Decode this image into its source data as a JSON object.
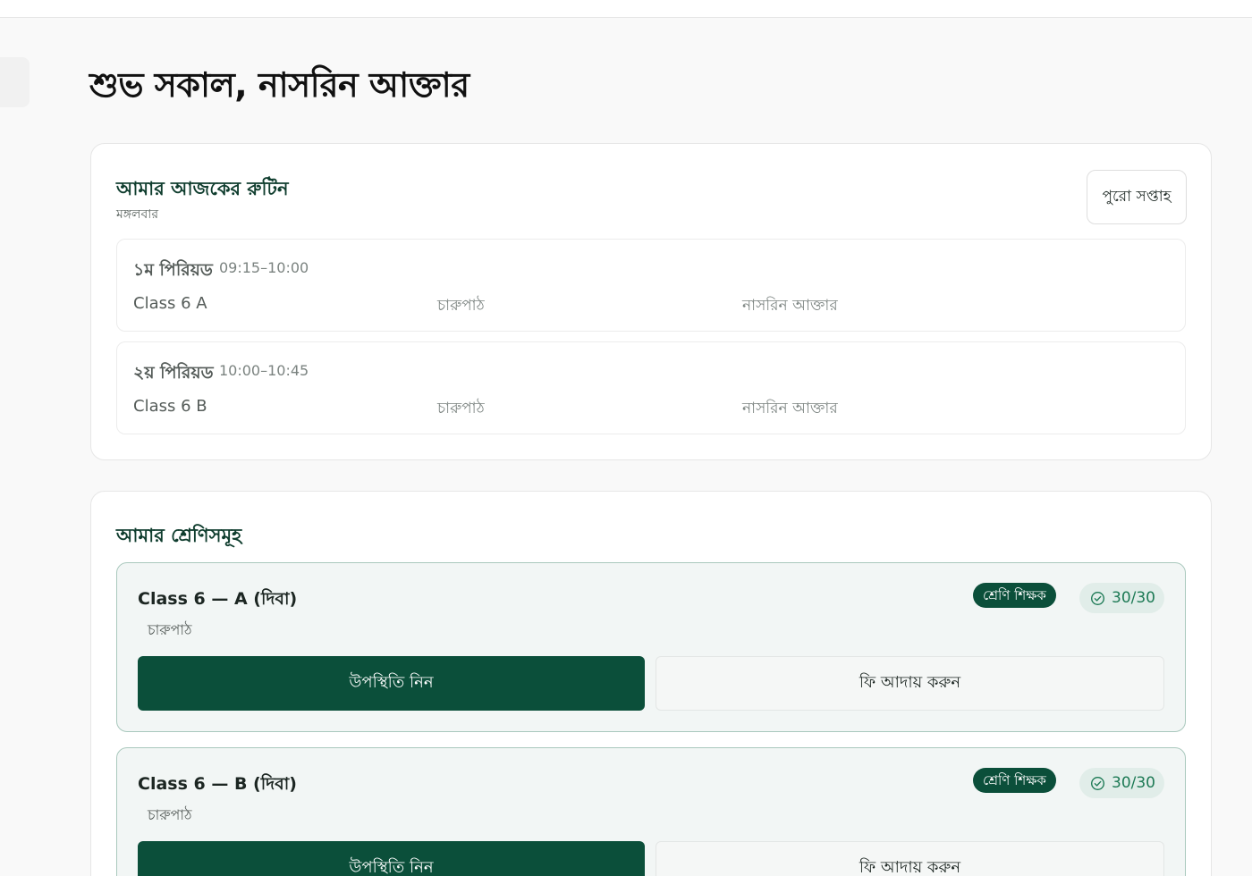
{
  "header": {
    "greeting": "শুভ সকাল, নাসরিন আক্তার"
  },
  "routine": {
    "title": "আমার আজকের রুটিন",
    "day": "মঙ্গলবার",
    "week_button": "পুরো সপ্তাহ",
    "periods": [
      {
        "name": "১ম পিরিয়ড",
        "time": "09:15–10:00",
        "class": "Class 6 A",
        "subject": "চারুপাঠ",
        "teacher": "নাসরিন আক্তার"
      },
      {
        "name": "২য় পিরিয়ড",
        "time": "10:00–10:45",
        "class": "Class 6 B",
        "subject": "চারুপাঠ",
        "teacher": "নাসরিন আক্তার"
      }
    ]
  },
  "classes": {
    "title": "আমার শ্রেণিসমূহ",
    "items": [
      {
        "name": "Class 6 — A (দিবা)",
        "role_badge": "শ্রেণি শিক্ষক",
        "attendance_count": "30/30",
        "subject": "চারুপাঠ",
        "attendance_button": "উপস্থিতি নিন",
        "fee_button": "ফি আদায় করুন"
      },
      {
        "name": "Class 6 — B (দিবা)",
        "role_badge": "শ্রেণি শিক্ষক",
        "attendance_count": "30/30",
        "subject": "চারুপাঠ",
        "attendance_button": "উপস্থিতি নিন",
        "fee_button": "ফি আদায় করুন"
      }
    ]
  },
  "icons": {
    "count_badge": "check-circle-icon"
  },
  "colors": {
    "primary": "#0b4f3a",
    "count_text": "#1d7a55",
    "class_card_border": "#a9c8bd"
  }
}
